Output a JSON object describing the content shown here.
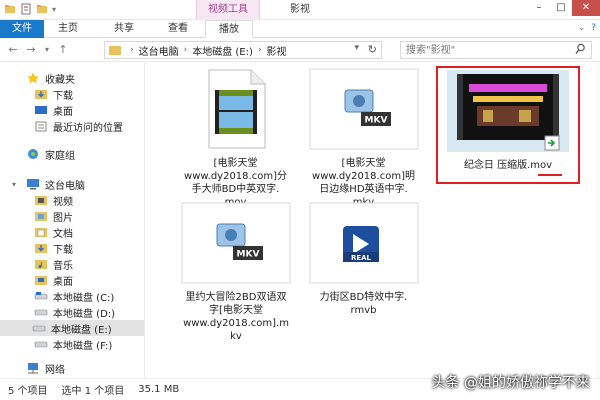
{
  "window": {
    "title": "影视",
    "context_tab": "视频工具",
    "buttons": {
      "minimize": "–",
      "maximize": "□",
      "close": "✕"
    }
  },
  "ribbon": {
    "tabs": [
      "文件",
      "主页",
      "共享",
      "查看",
      "播放"
    ]
  },
  "address": {
    "segments": [
      "这台电脑",
      "本地磁盘 (E:)",
      "影视"
    ],
    "search_placeholder": "搜索\"影视\""
  },
  "sidebar": {
    "items": [
      {
        "label": "收藏夹",
        "icon": "star-icon"
      },
      {
        "label": "下载",
        "icon": "download-folder-icon"
      },
      {
        "label": "桌面",
        "icon": "desktop-icon"
      },
      {
        "label": "最近访问的位置",
        "icon": "recent-places-icon"
      },
      {
        "label": "家庭组",
        "icon": "homegroup-icon"
      },
      {
        "label": "这台电脑",
        "icon": "computer-icon"
      },
      {
        "label": "视频",
        "icon": "videos-folder-icon"
      },
      {
        "label": "图片",
        "icon": "pictures-folder-icon"
      },
      {
        "label": "文档",
        "icon": "documents-folder-icon"
      },
      {
        "label": "下载",
        "icon": "download-folder-icon"
      },
      {
        "label": "音乐",
        "icon": "music-folder-icon"
      },
      {
        "label": "桌面",
        "icon": "desktop-icon"
      },
      {
        "label": "本地磁盘 (C:)",
        "icon": "drive-icon"
      },
      {
        "label": "本地磁盘 (D:)",
        "icon": "drive-icon"
      },
      {
        "label": "本地磁盘 (E:)",
        "icon": "drive-icon"
      },
      {
        "label": "本地磁盘 (F:)",
        "icon": "drive-icon"
      },
      {
        "label": "网络",
        "icon": "network-icon"
      }
    ]
  },
  "files": [
    {
      "name_lines": [
        "[电影天堂",
        "www.dy2018.com]分",
        "手大师BD中英双字.",
        "mov"
      ],
      "icon": "mov-file-icon"
    },
    {
      "name_lines": [
        "[电影天堂",
        "www.dy2018.com]明",
        "日边缘HD英语中字.",
        "mkv"
      ],
      "icon": "mkv-file-icon"
    },
    {
      "name_lines": [
        "纪念日    压缩版.mov"
      ],
      "icon": "video-thumbnail-icon"
    },
    {
      "name_lines": [
        "里约大冒险2BD双语双",
        "字[电影天堂",
        "www.dy2018.com].m",
        "kv"
      ],
      "icon": "mkv-file-icon"
    },
    {
      "name_lines": [
        "力街区BD特效中字.",
        "rmvb"
      ],
      "icon": "real-file-icon"
    }
  ],
  "status": {
    "count": "5 个项目",
    "selected": "选中 1 个项目",
    "size": "35.1 MB"
  },
  "watermark": "头条 @姐的娇傲祢学不来",
  "colors": {
    "file_tab": "#1979ca",
    "context_tab": "#a2458e",
    "selection_box": "#e02020"
  }
}
